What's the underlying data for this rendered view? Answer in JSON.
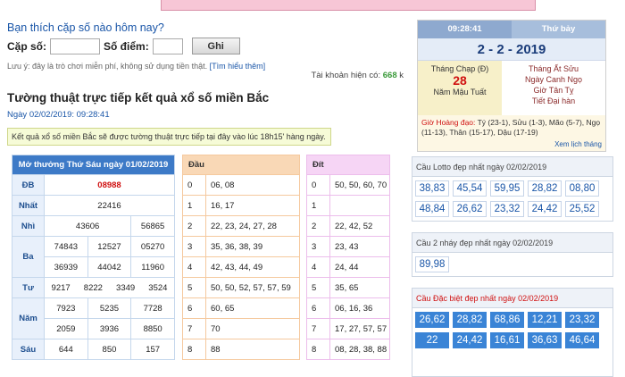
{
  "question": "Bạn thích cặp số nào hôm nay?",
  "form": {
    "pair_label": "Cặp số:",
    "points_label": "Số điểm:",
    "submit_label": "Ghi"
  },
  "note": {
    "text": "Lưu ý: đây là trò chơi miễn phí, không sử dụng tiền thật.",
    "link": "[Tìm hiểu thêm]"
  },
  "account": {
    "label": "Tài khoản hiện có:",
    "value": "668",
    "unit": "k"
  },
  "heading": "Tường thuật trực tiếp kết quả xổ số miền Bắc",
  "subheading": "Ngày 02/02/2019: 09:28:41",
  "notice": "Kết quả xổ số miền Bắc sẽ được tường thuật trực tiếp tại đây vào lúc 18h15' hàng ngày.",
  "results": {
    "title": "Mở thưởng Thứ Sáu ngày 01/02/2019",
    "db_label": "ĐB",
    "db": "08988",
    "nhat_label": "Nhất",
    "nhat": "22416",
    "nhi_label": "Nhì",
    "nhi": [
      "43606",
      "56865"
    ],
    "ba_label": "Ba",
    "ba": [
      "74843",
      "12527",
      "05270",
      "36939",
      "44042",
      "11960"
    ],
    "tu_label": "Tư",
    "tu": [
      "9217",
      "8222",
      "3349",
      "3524"
    ],
    "nam_label": "Năm",
    "nam": [
      "7923",
      "5235",
      "7728",
      "2059",
      "3936",
      "8850"
    ],
    "sau_label": "Sáu",
    "sau": [
      "644",
      "850",
      "157"
    ]
  },
  "dau": {
    "title": "Đầu",
    "rows": [
      {
        "n": "0",
        "v": "06, 08"
      },
      {
        "n": "1",
        "v": "16, 17"
      },
      {
        "n": "2",
        "v": "22, 23, 24, 27, 28"
      },
      {
        "n": "3",
        "v": "35, 36, 38, 39"
      },
      {
        "n": "4",
        "v": "42, 43, 44, 49"
      },
      {
        "n": "5",
        "v": "50, 50, 52, 57, 57, 59"
      },
      {
        "n": "6",
        "v": "60, 65"
      },
      {
        "n": "7",
        "v": "70"
      },
      {
        "n": "8",
        "v": "88"
      }
    ]
  },
  "dit": {
    "title": "Đít",
    "rows": [
      {
        "n": "0",
        "v": "50, 50, 60, 70"
      },
      {
        "n": "1",
        "v": ""
      },
      {
        "n": "2",
        "v": "22, 42, 52"
      },
      {
        "n": "3",
        "v": "23, 43"
      },
      {
        "n": "4",
        "v": "24, 44"
      },
      {
        "n": "5",
        "v": "35, 65"
      },
      {
        "n": "6",
        "v": "06, 16, 36"
      },
      {
        "n": "7",
        "v": "17, 27, 57, 57"
      },
      {
        "n": "8",
        "v": "08, 28, 38, 88"
      }
    ]
  },
  "calendar": {
    "time": "09:28:41",
    "weekday": "Thứ bảy",
    "date": "2 - 2 - 2019",
    "lunar_month": "Tháng Chạp (Đ)",
    "lunar_day": "28",
    "lunar_year": "Năm Mậu Tuất",
    "can_chi": [
      "Tháng Ất Sửu",
      "Ngày Canh Ngọ",
      "Giờ Tân Tỵ",
      "Tiết Đại hàn"
    ],
    "gio_hd_label": "Giờ Hoàng đạo:",
    "gio_hd": "Tý (23-1), Sửu (1-3), Mão (5-7), Ngọ (11-13), Thân (15-17), Dậu (17-19)",
    "more_link": "Xem lịch tháng"
  },
  "lotto": {
    "title": "Cầu Lotto đẹp nhất ngày 02/02/2019",
    "values": [
      "38,83",
      "45,54",
      "59,95",
      "28,82",
      "08,80",
      "48,84",
      "26,62",
      "23,32",
      "24,42",
      "25,52"
    ]
  },
  "lotto2": {
    "title": "Cầu 2 nháy đẹp nhất ngày 02/02/2019",
    "values": [
      "89,98"
    ]
  },
  "special": {
    "title": "Cầu Đặc biệt đẹp nhất ngày 02/02/2019",
    "values": [
      "26,62",
      "28,82",
      "68,86",
      "12,21",
      "23,32",
      "22",
      "24,42",
      "16,61",
      "36,63",
      "46,64"
    ]
  },
  "colors": {
    "accent": "#3d7ac7",
    "red": "#d01010",
    "green": "#3a9a3a"
  }
}
